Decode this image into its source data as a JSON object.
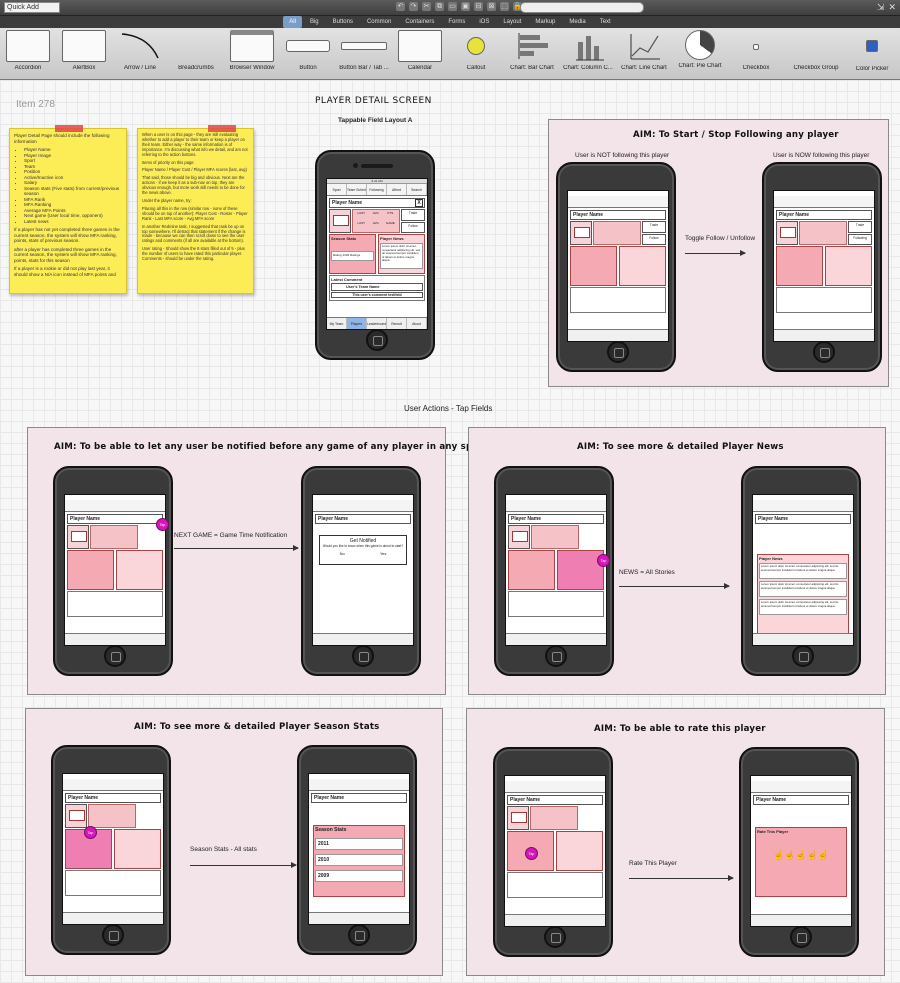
{
  "app": {
    "quick_add": "Quick Add",
    "filter_tabs": [
      "All",
      "Big",
      "Buttons",
      "Common",
      "Containers",
      "Forms",
      "iOS",
      "Layout",
      "Markup",
      "Media",
      "Text"
    ],
    "active_filter": "All",
    "library": [
      "Accordion",
      "AlertBox",
      "Arrow / Line",
      "Breadcrumbs",
      "Browser Window",
      "Button",
      "Button Bar / Tab ...",
      "Calendar",
      "Callout",
      "Chart: Bar Chart",
      "Chart: Column C...",
      "Chart: Line Chart",
      "Chart: Pie Chart",
      "Checkbox",
      "Checkbox Group",
      "Color Picker"
    ],
    "toolbar_glyphs": [
      "↶",
      "↷",
      "✂",
      "⧉",
      "▭",
      "▣",
      "⊟",
      "⊠",
      "⬚",
      "🔒"
    ],
    "window_glyphs": [
      "⇲",
      "✕"
    ]
  },
  "canvas": {
    "item_label": "Item 278",
    "main_title": "PLAYER DETAIL SCREEN",
    "layout_subtitle": "Tappable Field Layout A",
    "section_title": "User Actions - Tap Fields"
  },
  "note_left": {
    "intro": "Player Detail Page should include the following information",
    "items": [
      "Player Name",
      "Player Image",
      "Sport",
      "Team",
      "Position",
      "Active/Inactive icon",
      "Salary",
      "Season stats (Five stats) from current/previous season",
      "MFA Rank",
      "MFA Ranking",
      "Average MFA Points",
      "Next game (User local time, opponent)",
      "Latest news"
    ],
    "p1": "If a player has not yet completed three games in the current season, the system will show MFA ranking, points, stats of previous season.",
    "p2": "after a player has completed three games in the current season, the system will show MFA ranking, points, stats for this season",
    "p3": "If a player is a rookie or did not play last year, it should show a N/A icon instead of MFA points and"
  },
  "note_right": {
    "p1": "When a user is on this page - they are still evaluating whether to add a player to their team or keep a player on their team. Either way - the same information is of importance. I'm discussing what info we detail, and am not referring to the action buttons.",
    "p2": "Items of priority on this page:",
    "p3": "Player Name / Player Cost / Player MFA scores (last, avg)",
    "p4": "That said, those should be big and obvious. Next are the actions - if we keep it as a sub-nav on top, they are obvious enough, but more work still needs to be done for the news above.",
    "p5": "Under the player name, try:",
    "p6": "Placing all this in the row (similar row - none of these should be on top of another): Player Cost - Roster - Player Rank - Last MFA score - Avg MFA score",
    "p7": "In another Redmine task, I suggested that rank be up on top somewhere. I'll detract that statement if the change is made - because we can then scroll down to see the user ratings and comments (if all are available at the bottom).",
    "p8": "User rating - Should show the 8 stars filled out of 5 - plus the number of users to have rated this particular player. Comments - should be under the rating."
  },
  "screen": {
    "status": "9:41 AM",
    "top_tabs": [
      "Sport",
      "Team Schedule",
      "Following",
      "Afford",
      "Search"
    ],
    "player_name": "Player Name",
    "close": "X",
    "position": "Position",
    "team": "Player's Team",
    "stats": [
      "LAST",
      "AVG",
      "PTS",
      "LAST",
      "AVG",
      "GAME"
    ],
    "next_game": "Next Game Team Against Time Left 2:00pm",
    "follow": "Follow",
    "unfollow": "Following",
    "trade": "Trade",
    "season_stats": "Season Stats",
    "active": "Active",
    "rating": "Rating",
    "ratings_count": "1303 Ratings",
    "player_news": "Player News",
    "news_text": "Lorem ipsum dolor sit amet, consectetur adipiscing elit, sed do eiusmod tempor incididunt ut labore et dolore magna aliqua.",
    "latest_comment": "Latest Comment",
    "user_team": "User's Team Name",
    "comment": "This user's comment textfield",
    "see_more": "See More Comments",
    "bottom_tabs": [
      "My Team",
      "Players",
      "Leaderboard",
      "Recruit",
      "About"
    ],
    "selected_tab": "Players"
  },
  "panels": [
    {
      "title": "AIM: To Start / Stop Following any player",
      "label_a": "User is NOT following this player",
      "label_b": "User is NOW following this player",
      "arrow": "Toggle Follow / Unfollow"
    },
    {
      "title": "AIM: To be able to let any user be notified before any game of any player in any sport",
      "arrow": "NEXT GAME = Game Time Notification",
      "dialog_title": "Get Notified",
      "dialog_text": "Would you like to know when this game is about to start?",
      "dialog_no": "No",
      "dialog_yes": "Yes",
      "hotspot": "Tap"
    },
    {
      "title": "AIM: To see more & detailed Player News",
      "arrow": "NEWS = All Stories",
      "hotspot": "Tap"
    },
    {
      "title": "AIM: To see more & detailed Player Season Stats",
      "arrow": "Season Stats - All stats",
      "years": [
        "2011",
        "2010",
        "2009"
      ],
      "hotspot": "Tap"
    },
    {
      "title": "AIM: To be able to rate this player",
      "arrow": "Rate This Player",
      "rate_title": "Rate This Player",
      "hotspot": "Tap"
    }
  ]
}
